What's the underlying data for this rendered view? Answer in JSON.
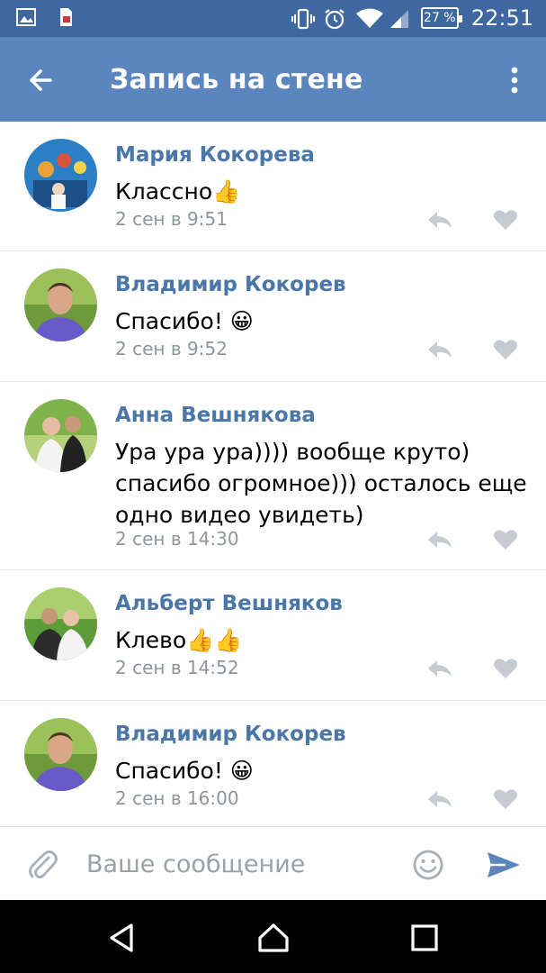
{
  "status_bar": {
    "time": "22:51",
    "battery": "27 %",
    "left_icons": [
      "gallery-icon",
      "sim-card-icon"
    ],
    "right_icons": [
      "vibrate-icon",
      "alarm-icon",
      "wifi-icon",
      "signal-icon",
      "battery-icon"
    ]
  },
  "app_bar": {
    "title": "Запись на стене",
    "back_icon": "arrow-left-icon",
    "menu_icon": "more-vertical-icon"
  },
  "comments": [
    {
      "author": "Мария Кокорева",
      "text": "Классно👍",
      "date": "2 сен в 9:51"
    },
    {
      "author": "Владимир Кокорев",
      "text": "Спасибо! 😀",
      "date": "2 сен в 9:52"
    },
    {
      "author": "Анна Вешнякова",
      "text": "Ура ура ура)))) вообще круто) спасибо огромное))) осталось еще одно видео увидеть)",
      "date": "2 сен в 14:30"
    },
    {
      "author": "Альберт Вешняков",
      "text": "Клево👍👍",
      "date": "2 сен в 14:52"
    },
    {
      "author": "Владимир Кокорев",
      "text": "Спасибо! 😀",
      "date": "2 сен в 16:00"
    }
  ],
  "composer": {
    "placeholder": "Ваше сообщение",
    "attach_icon": "paperclip-icon",
    "emoji_icon": "smile-icon",
    "send_icon": "send-icon"
  },
  "colors": {
    "status_bar": "#3f67a0",
    "app_bar": "#5b85bd",
    "author": "#4a76a8",
    "meta": "#8d969e",
    "action_icons": "#c5cbd1",
    "send": "#5b85bd"
  }
}
